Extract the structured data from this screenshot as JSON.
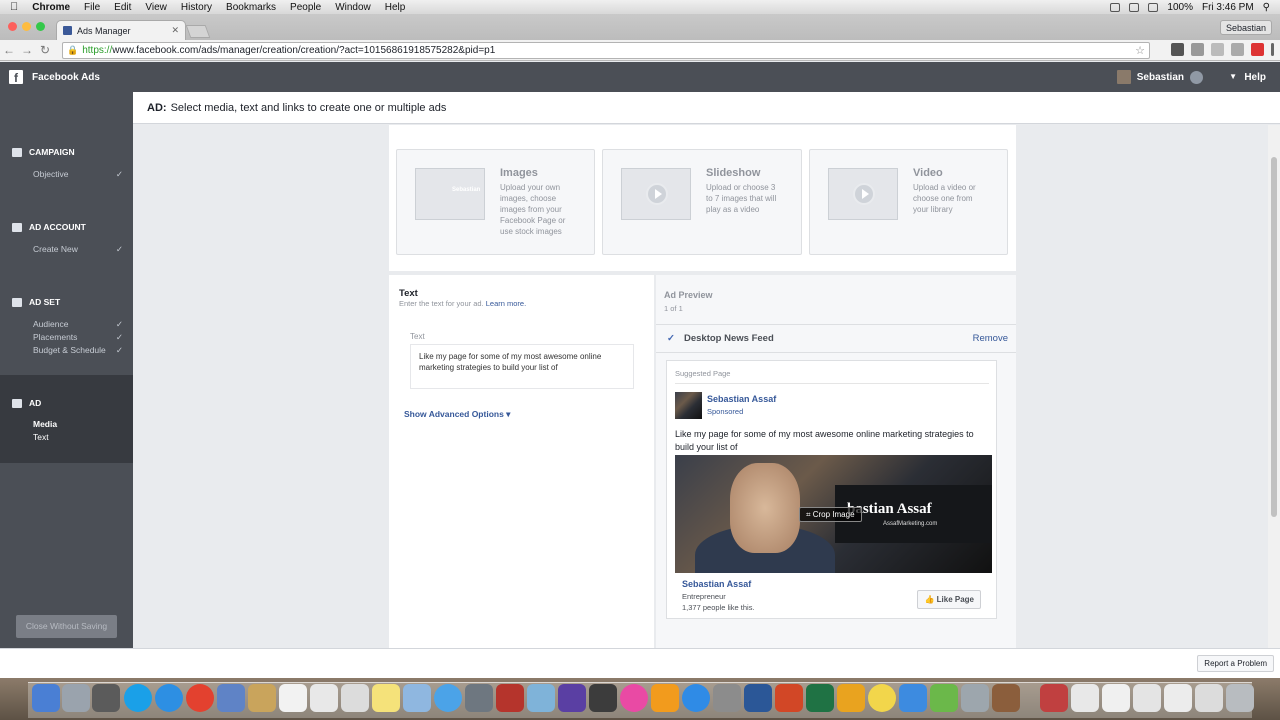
{
  "menubar": {
    "apple": "",
    "app": "Chrome",
    "items": [
      "File",
      "Edit",
      "View",
      "History",
      "Bookmarks",
      "People",
      "Window",
      "Help"
    ],
    "battery": "100%",
    "clock": "Fri 3:46 PM"
  },
  "browser": {
    "tab_title": "Ads Manager",
    "profile_name": "Sebastian",
    "url_scheme": "https://",
    "url_rest": "www.facebook.com/ads/manager/creation/creation/?act=10156861918575282&pid=p1"
  },
  "fb_header": {
    "logo": "f",
    "title": "Facebook Ads",
    "user_name": "Sebastian",
    "help": "Help"
  },
  "sidebar": {
    "campaign": {
      "label": "CAMPAIGN",
      "items": [
        {
          "label": "Objective",
          "check": "✓"
        }
      ]
    },
    "ad_account": {
      "label": "AD ACCOUNT",
      "items": [
        {
          "label": "Create New",
          "check": "✓"
        }
      ]
    },
    "ad_set": {
      "label": "AD SET",
      "items": [
        {
          "label": "Audience",
          "check": "✓"
        },
        {
          "label": "Placements",
          "check": "✓"
        },
        {
          "label": "Budget & Schedule",
          "check": "✓"
        }
      ]
    },
    "ad": {
      "label": "AD",
      "items": [
        {
          "label": "Media"
        },
        {
          "label": "Text"
        }
      ]
    },
    "close_button": "Close Without Saving"
  },
  "titlebar": {
    "prefix": "AD:",
    "text": "Select media, text and links to create one or multiple ads"
  },
  "media": [
    {
      "title": "Images",
      "desc": "Upload your own images, choose images from your Facebook Page or use stock images",
      "thumb_text": "Sebastian"
    },
    {
      "title": "Slideshow",
      "desc": "Upload or choose 3 to 7 images that will play as a video"
    },
    {
      "title": "Video",
      "desc": "Upload a video or choose one from your library"
    }
  ],
  "text_panel": {
    "heading": "Text",
    "desc": "Enter the text for your ad.",
    "learn_more": "Learn more.",
    "field_label": "Text",
    "field_value": "Like my page for some of my most awesome online marketing strategies to build your list of",
    "advanced": "Show Advanced Options ▾"
  },
  "preview": {
    "title": "Ad Preview",
    "count": "1 of 1",
    "placement_check": "✓",
    "placement": "Desktop News Feed",
    "remove": "Remove",
    "suggested": "Suggested Page",
    "page_name": "Sebastian Assaf",
    "sponsored": "Sponsored",
    "ad_text": "Like my page for some of my most awesome online marketing strategies to build your list of",
    "image_brand": "bastian Assaf",
    "image_sub": "AssafMarketing.com",
    "crop": "⌗ Crop Image",
    "category": "Entrepreneur",
    "likes": "1,377 people like this.",
    "like_button": "👍 Like Page"
  },
  "footer": {
    "report": "Report a Problem"
  }
}
